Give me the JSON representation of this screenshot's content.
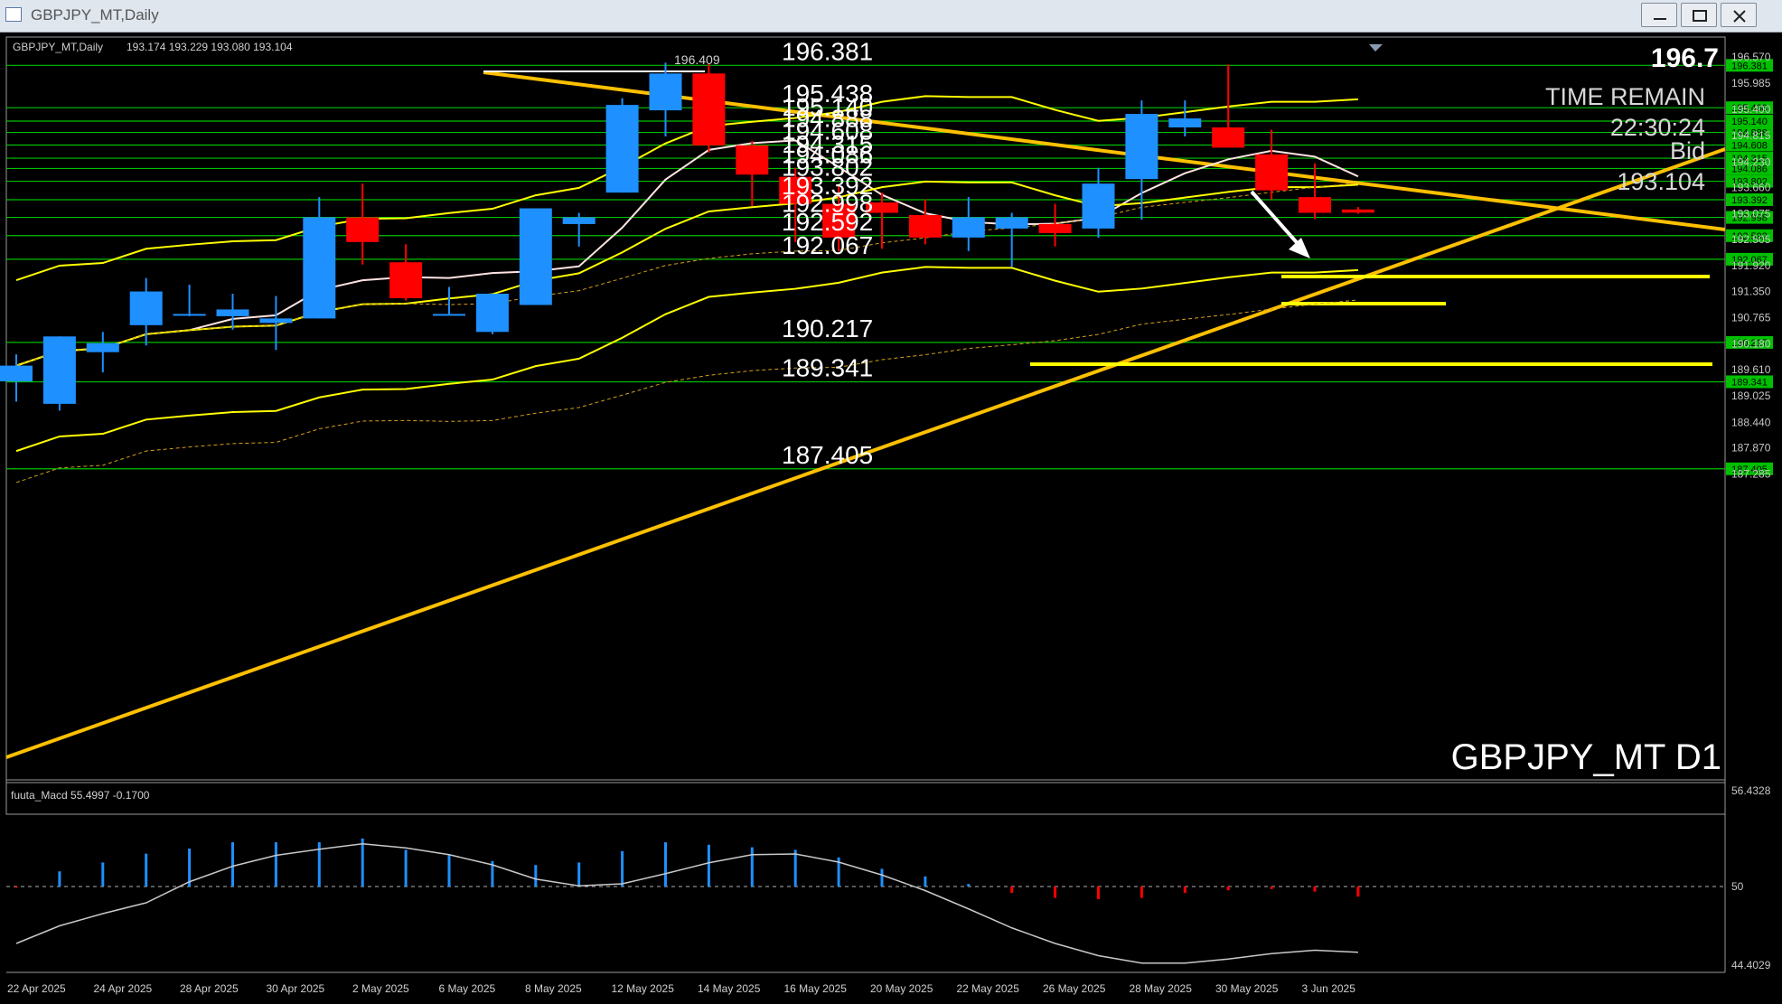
{
  "window": {
    "title": "GBPJPY_MT,Daily",
    "buttons": [
      "minimize-icon",
      "restore-icon",
      "close-icon"
    ]
  },
  "chart_header": {
    "symbol_period": "GBPJPY_MT,Daily",
    "ohlc": "193.174 193.229 193.080 193.104"
  },
  "overlay": {
    "top_price": "196.7",
    "time_remain_label": "TIME REMAIN",
    "time_remain_value": "22:30:24",
    "bid_label": "Bid",
    "bid_value": "193.104",
    "symbol_watermark": "GBPJPY_MT D1",
    "high_marker": "196.409"
  },
  "indicator": {
    "label": "fuuta_Macd 55.4997 -0.1700"
  },
  "colors": {
    "background": "#000000",
    "bull": "#1e90ff",
    "bear": "#ff0000",
    "level_line": "#00c800",
    "trend_line": "#ffc000",
    "band": "#ffff00",
    "ma_fast": "#ffe4e1",
    "axis_text": "#c8c8c8"
  },
  "chart_data": {
    "type": "candlestick",
    "symbol": "GBPJPY_MT",
    "timeframe": "Daily",
    "ylim": [
      187.285,
      196.7
    ],
    "price_axis_ticks": [
      "196.570",
      "195.985",
      "195.400",
      "194.815",
      "194.230",
      "193.660",
      "193.075",
      "192.505",
      "191.920",
      "191.350",
      "190.765",
      "190.180",
      "189.610",
      "189.025",
      "188.440",
      "187.870",
      "187.285"
    ],
    "horizontal_levels": [
      "196.381",
      "195.438",
      "195.140",
      "194.888",
      "194.608",
      "194.315",
      "194.086",
      "193.802",
      "193.392",
      "192.998",
      "192.592",
      "192.067",
      "190.217",
      "189.341",
      "187.405"
    ],
    "x_labels": [
      "22 Apr 2025",
      "24 Apr 2025",
      "28 Apr 2025",
      "30 Apr 2025",
      "2 May 2025",
      "6 May 2025",
      "8 May 2025",
      "12 May 2025",
      "14 May 2025",
      "16 May 2025",
      "20 May 2025",
      "22 May 2025",
      "26 May 2025",
      "28 May 2025",
      "30 May 2025",
      "3 Jun 2025"
    ],
    "candles": [
      {
        "o": 189.35,
        "h": 189.95,
        "l": 188.9,
        "c": 189.7
      },
      {
        "o": 188.85,
        "h": 190.35,
        "l": 188.7,
        "c": 190.35
      },
      {
        "o": 190.0,
        "h": 190.45,
        "l": 189.55,
        "c": 190.2
      },
      {
        "o": 190.6,
        "h": 191.65,
        "l": 190.15,
        "c": 191.35
      },
      {
        "o": 190.85,
        "h": 191.5,
        "l": 190.8,
        "c": 190.85
      },
      {
        "o": 190.8,
        "h": 191.3,
        "l": 190.5,
        "c": 190.95
      },
      {
        "o": 190.65,
        "h": 191.25,
        "l": 190.05,
        "c": 190.75
      },
      {
        "o": 190.75,
        "h": 193.45,
        "l": 190.75,
        "c": 193.0
      },
      {
        "o": 193.0,
        "h": 193.75,
        "l": 191.95,
        "c": 192.45
      },
      {
        "o": 192.0,
        "h": 192.4,
        "l": 191.15,
        "c": 191.2
      },
      {
        "o": 190.85,
        "h": 191.45,
        "l": 190.85,
        "c": 190.85
      },
      {
        "o": 190.45,
        "h": 191.25,
        "l": 190.4,
        "c": 191.3
      },
      {
        "o": 191.05,
        "h": 193.2,
        "l": 191.05,
        "c": 193.2
      },
      {
        "o": 192.85,
        "h": 193.1,
        "l": 192.35,
        "c": 193.0
      },
      {
        "o": 193.55,
        "h": 195.65,
        "l": 193.55,
        "c": 195.5
      },
      {
        "o": 195.38,
        "h": 196.44,
        "l": 194.8,
        "c": 196.2
      },
      {
        "o": 196.2,
        "h": 196.41,
        "l": 194.44,
        "c": 194.6
      },
      {
        "o": 194.6,
        "h": 194.7,
        "l": 193.25,
        "c": 193.95
      },
      {
        "o": 193.9,
        "h": 194.1,
        "l": 192.45,
        "c": 193.3
      },
      {
        "o": 193.3,
        "h": 193.7,
        "l": 192.25,
        "c": 192.55
      },
      {
        "o": 193.33,
        "h": 193.55,
        "l": 192.3,
        "c": 193.1
      },
      {
        "o": 193.05,
        "h": 193.4,
        "l": 192.4,
        "c": 192.55
      },
      {
        "o": 192.55,
        "h": 193.45,
        "l": 192.25,
        "c": 193.0
      },
      {
        "o": 192.75,
        "h": 193.1,
        "l": 191.9,
        "c": 193.0
      },
      {
        "o": 192.85,
        "h": 193.3,
        "l": 192.35,
        "c": 192.65
      },
      {
        "o": 192.75,
        "h": 194.1,
        "l": 192.55,
        "c": 193.75
      },
      {
        "o": 193.85,
        "h": 195.6,
        "l": 192.95,
        "c": 195.3
      },
      {
        "o": 195.0,
        "h": 195.6,
        "l": 194.8,
        "c": 195.2
      },
      {
        "o": 195.0,
        "h": 196.4,
        "l": 194.8,
        "c": 194.55
      },
      {
        "o": 194.4,
        "h": 194.95,
        "l": 193.4,
        "c": 193.6
      },
      {
        "o": 193.45,
        "h": 194.2,
        "l": 192.96,
        "c": 193.1
      },
      {
        "o": 193.174,
        "h": 193.229,
        "l": 193.08,
        "c": 193.104
      }
    ],
    "indicator": {
      "name": "fuuta_Macd",
      "value": 55.4997,
      "signal": -0.17,
      "ylim": [
        44.4029,
        56.4328
      ],
      "zero_tick": "50",
      "axis_ticks": [
        "56.4328",
        "50",
        "44.4029"
      ],
      "histogram": [
        -0.1,
        1.2,
        1.9,
        2.6,
        3.0,
        3.5,
        3.5,
        3.5,
        3.8,
        2.9,
        2.5,
        2.0,
        1.7,
        1.9,
        2.8,
        3.5,
        3.3,
        3.1,
        2.9,
        2.3,
        1.4,
        0.8,
        0.2,
        -0.5,
        -0.9,
        -1.0,
        -0.9,
        -0.5,
        -0.3,
        -0.2,
        -0.4,
        -0.8
      ]
    }
  }
}
